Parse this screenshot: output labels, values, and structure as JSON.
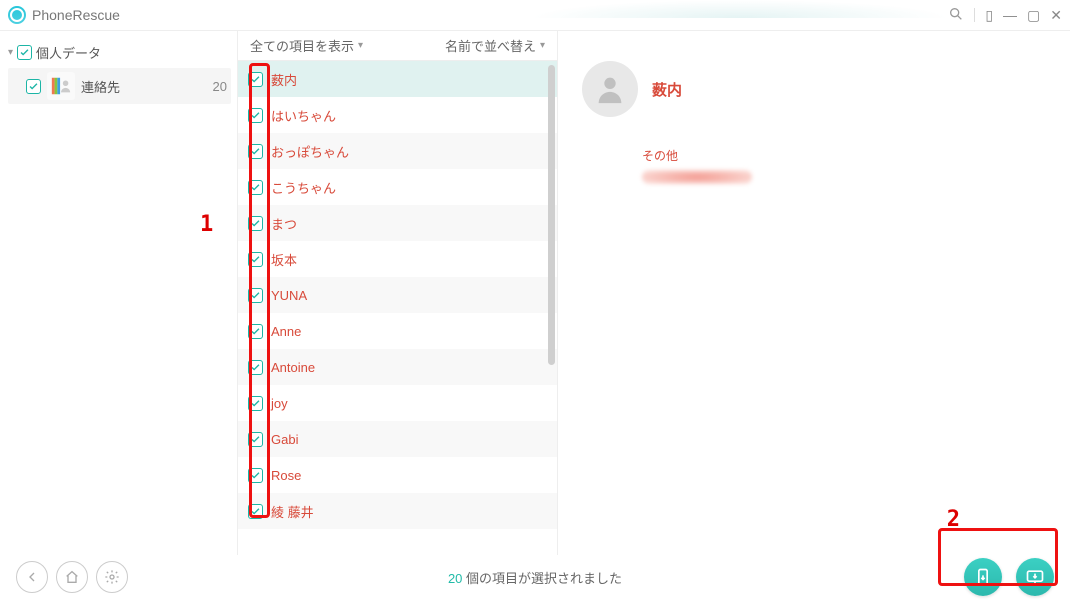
{
  "app_name": "PhoneRescue",
  "sidebar": {
    "root_label": "個人データ",
    "items": [
      {
        "label": "連絡先",
        "count": "20"
      }
    ]
  },
  "list_header": {
    "filter_label": "全ての項目を表示",
    "sort_label": "名前で並べ替え"
  },
  "contacts": [
    {
      "name": "薮内",
      "selected": true
    },
    {
      "name": "はいちゃん"
    },
    {
      "name": "おっぽちゃん"
    },
    {
      "name": "こうちゃん"
    },
    {
      "name": "まつ"
    },
    {
      "name": "坂本"
    },
    {
      "name": "YUNA"
    },
    {
      "name": "Anne"
    },
    {
      "name": "Antoine"
    },
    {
      "name": "joy"
    },
    {
      "name": "Gabi"
    },
    {
      "name": "Rose"
    },
    {
      "name": "綾 藤井"
    }
  ],
  "detail": {
    "name": "薮内",
    "section_label": "その他"
  },
  "footer": {
    "count": "20",
    "status_suffix": " 個の項目が選択されました"
  },
  "annotations": {
    "one": "1",
    "two": "2"
  }
}
